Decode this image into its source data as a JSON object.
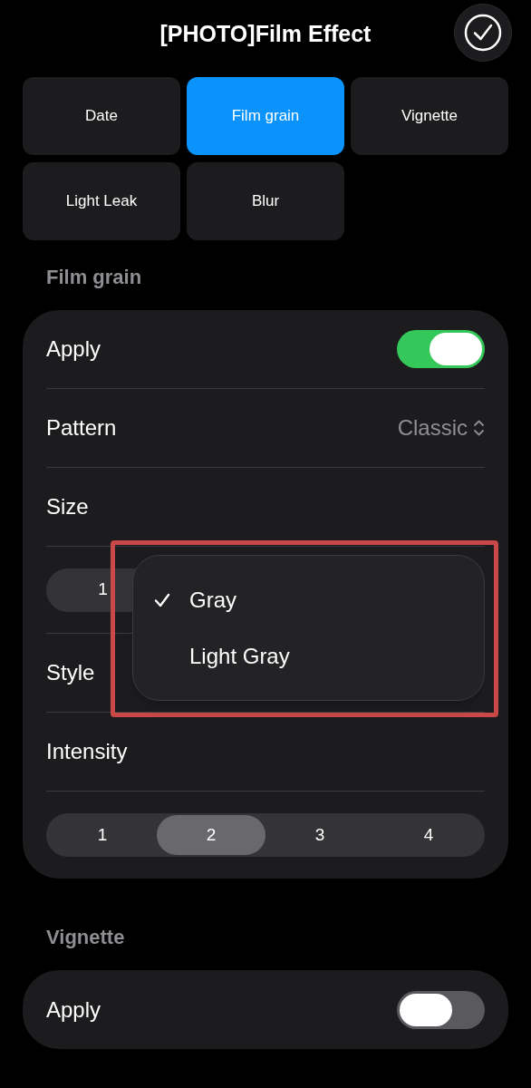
{
  "header": {
    "title": "[PHOTO]Film Effect"
  },
  "tabs": [
    {
      "label": "Date",
      "selected": false
    },
    {
      "label": "Film grain",
      "selected": true
    },
    {
      "label": "Vignette",
      "selected": false
    },
    {
      "label": "Light Leak",
      "selected": false
    },
    {
      "label": "Blur",
      "selected": false
    }
  ],
  "sections": [
    {
      "title": "Film grain",
      "rows": [
        {
          "kind": "toggle",
          "label": "Apply",
          "on": true
        },
        {
          "kind": "picker",
          "label": "Pattern",
          "value": "Classic"
        },
        {
          "kind": "label",
          "label": "Size"
        },
        {
          "kind": "segmented",
          "segments": [
            {
              "label": "1"
            }
          ]
        },
        {
          "kind": "label",
          "label": "Style"
        },
        {
          "kind": "label",
          "label": "Intensity"
        },
        {
          "kind": "segmented",
          "segments": [
            {
              "label": "1",
              "selected": false
            },
            {
              "label": "2",
              "selected": true
            },
            {
              "label": "3",
              "selected": false
            },
            {
              "label": "4",
              "selected": false
            }
          ]
        }
      ],
      "menu": {
        "items": [
          {
            "label": "Gray",
            "checked": true
          },
          {
            "label": "Light Gray",
            "checked": false
          }
        ]
      }
    },
    {
      "title": "Vignette",
      "rows": [
        {
          "kind": "toggle",
          "label": "Apply",
          "on": false
        }
      ]
    }
  ]
}
